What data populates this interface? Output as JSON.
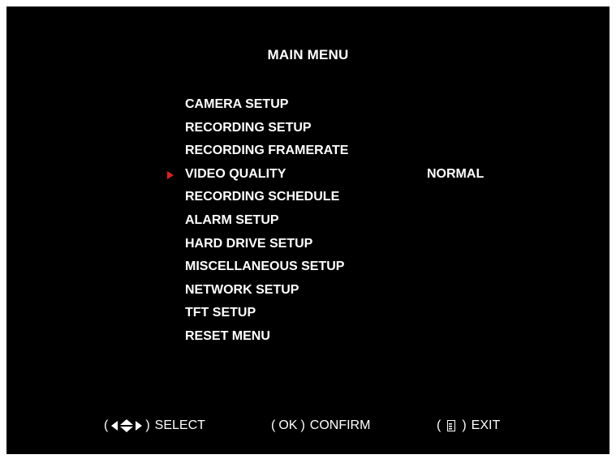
{
  "header": {
    "title": "MAIN MENU"
  },
  "menu": {
    "selected_index": 3,
    "cursor_color": "#e0201c",
    "items": [
      {
        "label": "CAMERA SETUP",
        "value": ""
      },
      {
        "label": "RECORDING SETUP",
        "value": ""
      },
      {
        "label": "RECORDING FRAMERATE",
        "value": ""
      },
      {
        "label": "VIDEO QUALITY",
        "value": "NORMAL"
      },
      {
        "label": "RECORDING SCHEDULE",
        "value": ""
      },
      {
        "label": "ALARM SETUP",
        "value": ""
      },
      {
        "label": "HARD DRIVE SETUP",
        "value": ""
      },
      {
        "label": "MISCELLANEOUS SETUP",
        "value": ""
      },
      {
        "label": "NETWORK SETUP",
        "value": ""
      },
      {
        "label": "TFT SETUP",
        "value": ""
      },
      {
        "label": "RESET MENU",
        "value": ""
      }
    ]
  },
  "footer": {
    "select": {
      "open": "(",
      "close": ")",
      "label": "SELECT",
      "icon": "direction-arrows-icon"
    },
    "confirm": {
      "open": "(",
      "key": "OK",
      "close": ")",
      "label": "CONFIRM"
    },
    "exit": {
      "open": "(",
      "close": ")",
      "label": "EXIT",
      "icon": "menu-key-icon"
    }
  }
}
